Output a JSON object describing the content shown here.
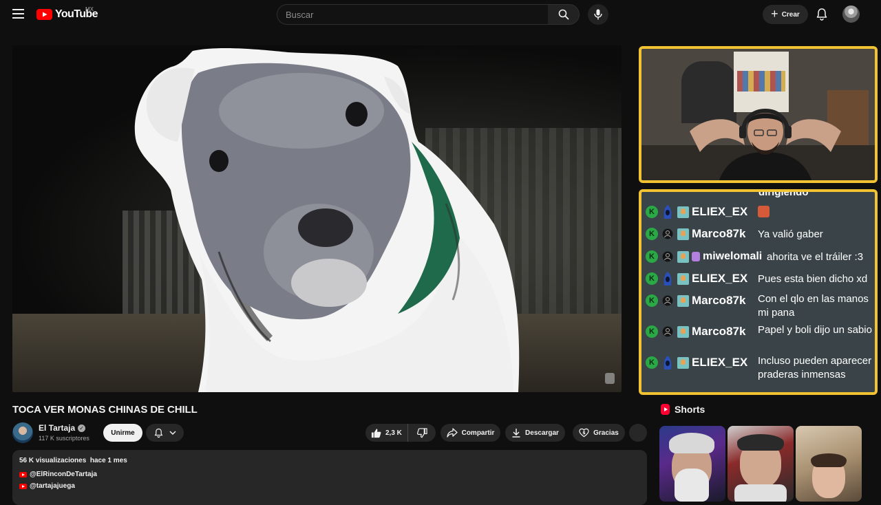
{
  "header": {
    "logo_text": "YouTube",
    "logo_country": "MX",
    "search_placeholder": "Buscar",
    "create_label": "Crear"
  },
  "video": {
    "title": "TOCA VER MONAS CHINAS DE CHILL"
  },
  "channel": {
    "name": "El Tartaja",
    "subscribers": "117 K suscriptores",
    "join_label": "Unirme"
  },
  "actions": {
    "likes": "2,3 K",
    "share_label": "Compartir",
    "download_label": "Descargar",
    "thanks_label": "Gracias"
  },
  "description": {
    "views": "56 K visualizaciones",
    "date": "hace 1 mes",
    "links": [
      "@ElRinconDeTartaja",
      "@tartajajuega"
    ]
  },
  "chat": {
    "cut_text": "dirigiendo",
    "messages": [
      {
        "user": "ELIEX_EX",
        "role": "blue",
        "text": "",
        "emote": true
      },
      {
        "user": "Marco87k",
        "role": "gray",
        "text": "Ya valió gaber"
      },
      {
        "user": "miwelomali",
        "role": "gray",
        "text": "ahorita ve el tráiler :3",
        "extra_badge": true
      },
      {
        "user": "ELIEX_EX",
        "role": "blue",
        "text": "Pues esta bien dicho xd"
      },
      {
        "user": "Marco87k",
        "role": "gray",
        "text": "Con el qlo en las manos mi pana"
      },
      {
        "user": "Marco87k",
        "role": "gray",
        "text": "Papel y boli dijo un sabio"
      },
      {
        "user": "ELIEX_EX",
        "role": "blue",
        "text": "Incluso pueden aparecer praderas inmensas"
      }
    ]
  },
  "shorts": {
    "title": "Shorts"
  },
  "colors": {
    "accent_frame": "#f1c232",
    "brand_red": "#ff0000",
    "background": "#0f0f0f"
  }
}
